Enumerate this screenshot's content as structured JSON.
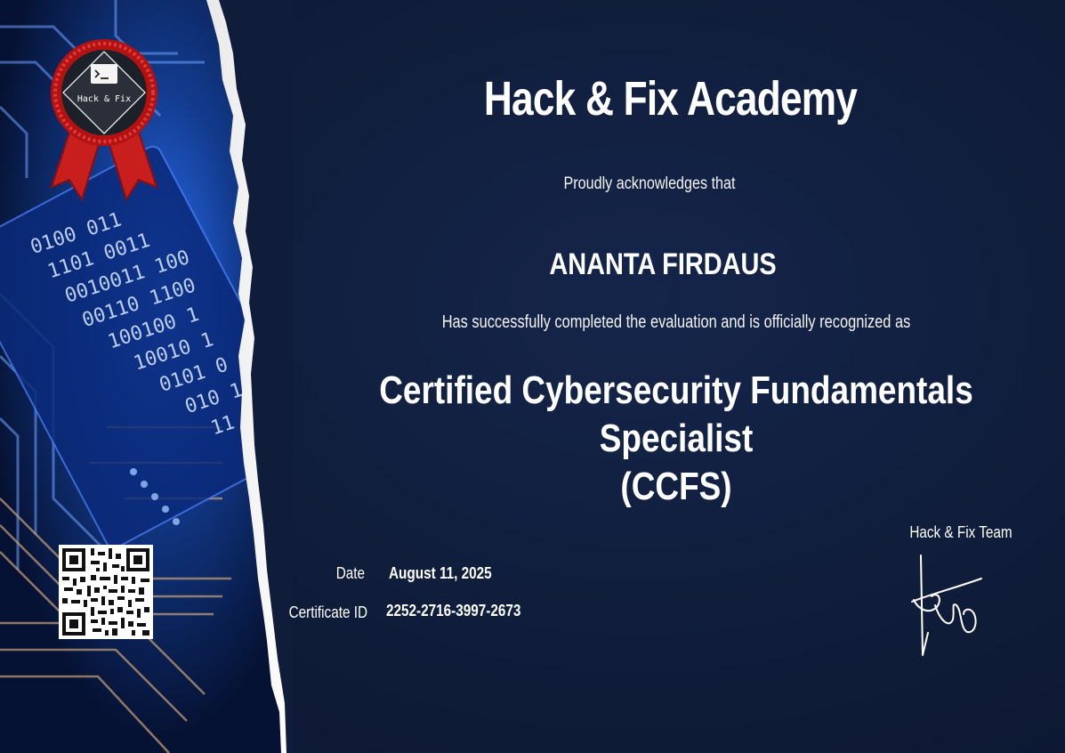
{
  "seal": {
    "logo_text": "Hack & Fix",
    "icon": "terminal-icon"
  },
  "header": {
    "title": "Hack & Fix Academy"
  },
  "intro": "Proudly acknowledges that",
  "recipient_name": "ANANTA FIRDAUS",
  "statement": "Has successfully completed the evaluation and is officially recognized as",
  "certification": {
    "line1": "Certified Cybersecurity Fundamentals Specialist",
    "line2": "(CCFS)"
  },
  "details": {
    "date_label": "Date",
    "date_value": "August 11, 2025",
    "id_label": "Certificate ID",
    "id_value": "2252-2716-3997-2673"
  },
  "signatory": {
    "team": "Hack & Fix Team"
  },
  "colors": {
    "background": "#0f1d3a",
    "accent_blue": "#3b82f6",
    "ribbon_red": "#c81e1e",
    "text": "#ffffff"
  }
}
